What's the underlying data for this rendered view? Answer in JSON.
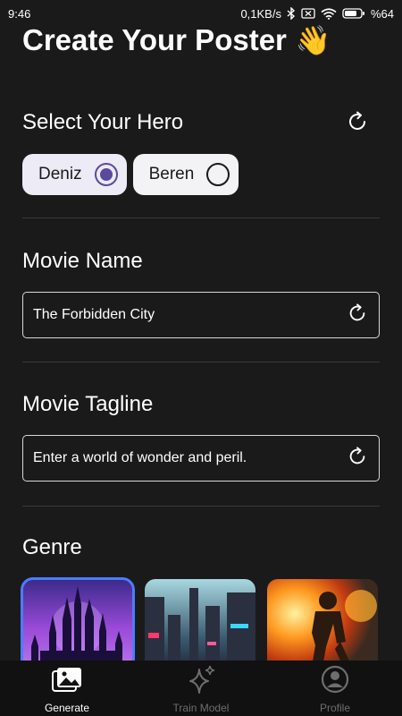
{
  "status_bar": {
    "time": "9:46",
    "network_speed": "0,1KB/s",
    "battery": "%64"
  },
  "page": {
    "title": "Create Your Poster",
    "title_emoji": "👋"
  },
  "hero_section": {
    "title": "Select Your Hero",
    "options": [
      {
        "label": "Deniz",
        "selected": true
      },
      {
        "label": "Beren",
        "selected": false
      }
    ]
  },
  "movie_name": {
    "title": "Movie Name",
    "value": "The Forbidden City"
  },
  "movie_tagline": {
    "title": "Movie Tagline",
    "value": "Enter a world of wonder and peril."
  },
  "genre": {
    "title": "Genre",
    "cards": [
      {
        "name": "fantasy-castle",
        "selected": true
      },
      {
        "name": "cyberpunk-city",
        "selected": false
      },
      {
        "name": "action-explosion",
        "selected": false
      }
    ]
  },
  "bottom_nav": {
    "items": [
      {
        "label": "Generate",
        "icon": "image-icon",
        "active": true
      },
      {
        "label": "Train Model",
        "icon": "sparkles-icon",
        "active": false
      },
      {
        "label": "Profile",
        "icon": "profile-icon",
        "active": false
      }
    ]
  },
  "colors": {
    "background": "#1a1a1a",
    "accent": "#5a4a9e",
    "selected_outline": "#4a7dff"
  }
}
